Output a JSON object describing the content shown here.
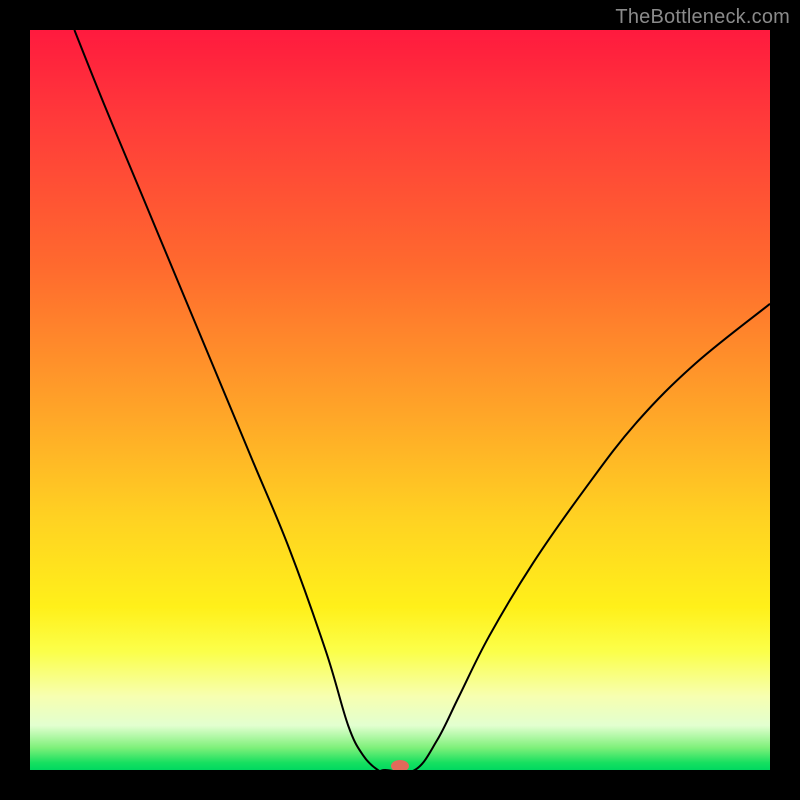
{
  "watermark": "TheBottleneck.com",
  "chart_data": {
    "type": "line",
    "title": "",
    "xlabel": "",
    "ylabel": "",
    "xlim": [
      0,
      100
    ],
    "ylim": [
      0,
      100
    ],
    "grid": false,
    "legend": false,
    "series": [
      {
        "name": "curve",
        "x": [
          6,
          10,
          15,
          20,
          25,
          30,
          35,
          40,
          43,
          45,
          47,
          48,
          52,
          55,
          58,
          62,
          68,
          75,
          82,
          90,
          100
        ],
        "y": [
          100,
          90,
          78,
          66,
          54,
          42,
          30,
          16,
          6,
          2,
          0,
          0,
          0,
          4,
          10,
          18,
          28,
          38,
          47,
          55,
          63
        ]
      }
    ],
    "marker": {
      "x": 50,
      "y": 0,
      "color": "#e06a5a"
    },
    "background_gradient": {
      "top": "#ff1a3e",
      "mid": "#ffd222",
      "bottom": "#00d860"
    }
  }
}
